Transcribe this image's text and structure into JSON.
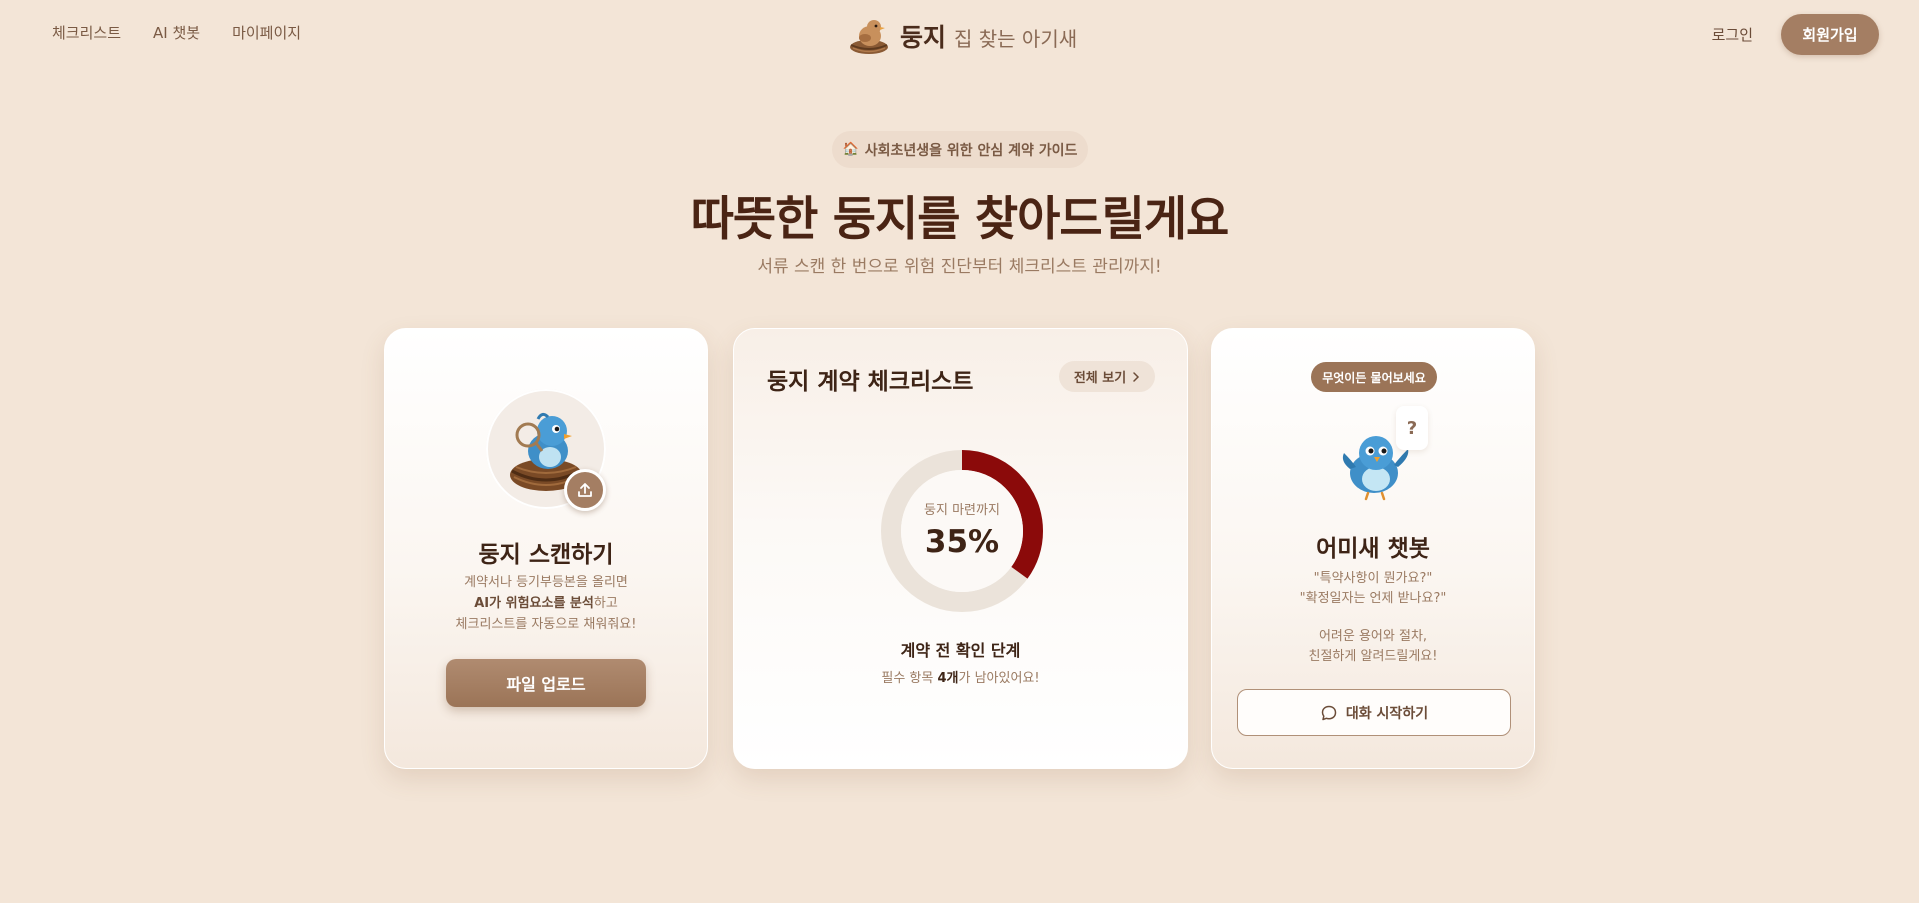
{
  "nav": {
    "items": [
      {
        "label": "체크리스트"
      },
      {
        "label": "AI 챗봇"
      },
      {
        "label": "마이페이지"
      }
    ],
    "brand_name": "둥지",
    "brand_tagline": "집 찾는 아기새",
    "login": "로그인",
    "signup": "회원가입"
  },
  "hero": {
    "badge_icon": "🏠",
    "badge_text": "사회초년생을 위한 안심 계약 가이드",
    "title": "따뜻한 둥지를 찾아드릴게요",
    "subtitle": "서류 스캔 한 번으로 위험 진단부터 체크리스트 관리까지!"
  },
  "scan_card": {
    "title": "둥지 스캔하기",
    "desc_line1": "계약서나 등기부등본을 올리면",
    "desc_line2_bold": "AI가 위험요소를 분석",
    "desc_line2_rest": "하고",
    "desc_line3": "체크리스트를 자동으로 채워줘요!",
    "button": "파일 업로드"
  },
  "checklist_card": {
    "title": "둥지 계약 체크리스트",
    "view_all": "전체 보기",
    "progress_label": "둥지 마련까지",
    "progress_text": "35%",
    "progress_value": 0.35,
    "stage_title": "계약 전 확인 단계",
    "stage_desc_prefix": "필수 항목 ",
    "stage_desc_count": "4개",
    "stage_desc_suffix": "가 남아있어요!"
  },
  "chat_card": {
    "pill": "무엇이든 물어보세요",
    "question_mark": "?",
    "title": "어미새 챗봇",
    "q1": "\"특약사항이 뭔가요?\"",
    "q2": "\"확정일자는 언제 받나요?\"",
    "desc1": "어려운 용어와 절차,",
    "desc2": "친절하게 알려드릴게요!",
    "button": "대화 시작하기"
  },
  "colors": {
    "background": "#f3e5d7",
    "accent": "#a47e63",
    "progress": "#8b0a0a",
    "track": "#ebe3da"
  }
}
